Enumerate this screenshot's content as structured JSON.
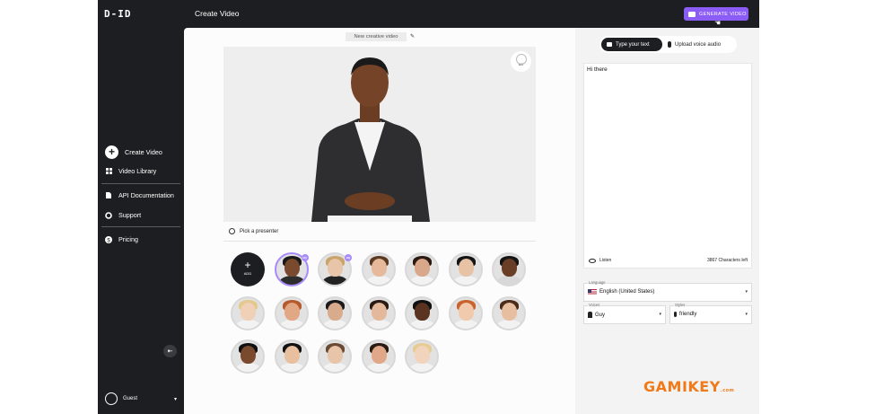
{
  "app": {
    "logo": "D-ID",
    "page_title": "Create Video",
    "generate_button": "GENERATE VIDEO"
  },
  "sidebar": {
    "items": [
      {
        "label": "Create Video",
        "icon": "plus-icon"
      },
      {
        "label": "Video Library",
        "icon": "grid-icon"
      },
      {
        "label": "API Documentation",
        "icon": "document-icon"
      },
      {
        "label": "Support",
        "icon": "gear-icon"
      },
      {
        "label": "Pricing",
        "icon": "dollar-icon"
      }
    ],
    "user": {
      "name": "Guest"
    }
  },
  "main": {
    "video_name": "New creative video",
    "bg_button_label": "BG",
    "pick_presenter_label": "Pick a presenter",
    "add_label": "ADD",
    "hq_badge": "HQ"
  },
  "presenters": [
    {
      "skin": "#7a4a2e",
      "hair": "#1a1a1a",
      "shirt": "#2d2d2d",
      "hq": true,
      "selected": true
    },
    {
      "skin": "#e8c4a8",
      "hair": "#c9a46b",
      "shirt": "#222",
      "hq": true,
      "selected": false
    },
    {
      "skin": "#e5b99a",
      "hair": "#5a3a22",
      "shirt": "#f2f2f2",
      "hq": false,
      "selected": false
    },
    {
      "skin": "#d9a789",
      "hair": "#2a1a12",
      "shirt": "#f2f2f2",
      "hq": false,
      "selected": false
    },
    {
      "skin": "#e7c2a4",
      "hair": "#151515",
      "shirt": "#f2f2f2",
      "hq": false,
      "selected": false
    },
    {
      "skin": "#6a3e26",
      "hair": "#151515",
      "shirt": "#d8d8d8",
      "hq": false,
      "selected": false
    },
    {
      "skin": "#f0d0b6",
      "hair": "#e3c98e",
      "shirt": "#f2f2f2",
      "hq": false,
      "selected": false
    },
    {
      "skin": "#e2a784",
      "hair": "#b45a2c",
      "shirt": "#f2f2f2",
      "hq": false,
      "selected": false
    },
    {
      "skin": "#d8ab8c",
      "hair": "#1a1a1a",
      "shirt": "#f2f2f2",
      "hq": false,
      "selected": false
    },
    {
      "skin": "#e4b99b",
      "hair": "#2a1a12",
      "shirt": "#f2f2f2",
      "hq": false,
      "selected": false
    },
    {
      "skin": "#5a3420",
      "hair": "#111",
      "shirt": "#f2f2f2",
      "hq": false,
      "selected": false
    },
    {
      "skin": "#f1c9ad",
      "hair": "#c9622c",
      "shirt": "#f2f2f2",
      "hq": false,
      "selected": false
    },
    {
      "skin": "#e8bea0",
      "hair": "#4a2c18",
      "shirt": "#f2f2f2",
      "hq": false,
      "selected": false
    },
    {
      "skin": "#7a4a2e",
      "hair": "#111",
      "shirt": "#f2f2f2",
      "hq": false,
      "selected": false
    },
    {
      "skin": "#e8c0a0",
      "hair": "#111",
      "shirt": "#f2f2f2",
      "hq": false,
      "selected": false
    },
    {
      "skin": "#e8c4a8",
      "hair": "#6a4a32",
      "shirt": "#f2f2f2",
      "hq": false,
      "selected": false
    },
    {
      "skin": "#e0a788",
      "hair": "#2a1a12",
      "shirt": "#f2f2f2",
      "hq": false,
      "selected": false
    },
    {
      "skin": "#f2d4bd",
      "hair": "#e6cc92",
      "shirt": "#f2f2f2",
      "hq": false,
      "selected": false
    }
  ],
  "right": {
    "tab_text": "Type your text",
    "tab_audio": "Upload voice audio",
    "script_text": "Hi there",
    "listen_label": "Listen",
    "chars_left": "3867 Characters left",
    "language_label": "Language",
    "language_value": "English (United States)",
    "voices_label": "Voices",
    "voices_value": "Guy",
    "styles_label": "Styles",
    "styles_value": "friendly"
  },
  "watermark": {
    "text": "GAMIKEY",
    "suffix": ".com"
  },
  "colors": {
    "accent": "#8b5cf6",
    "sidebar": "#1d1e21",
    "watermark": "#f07a1a"
  }
}
